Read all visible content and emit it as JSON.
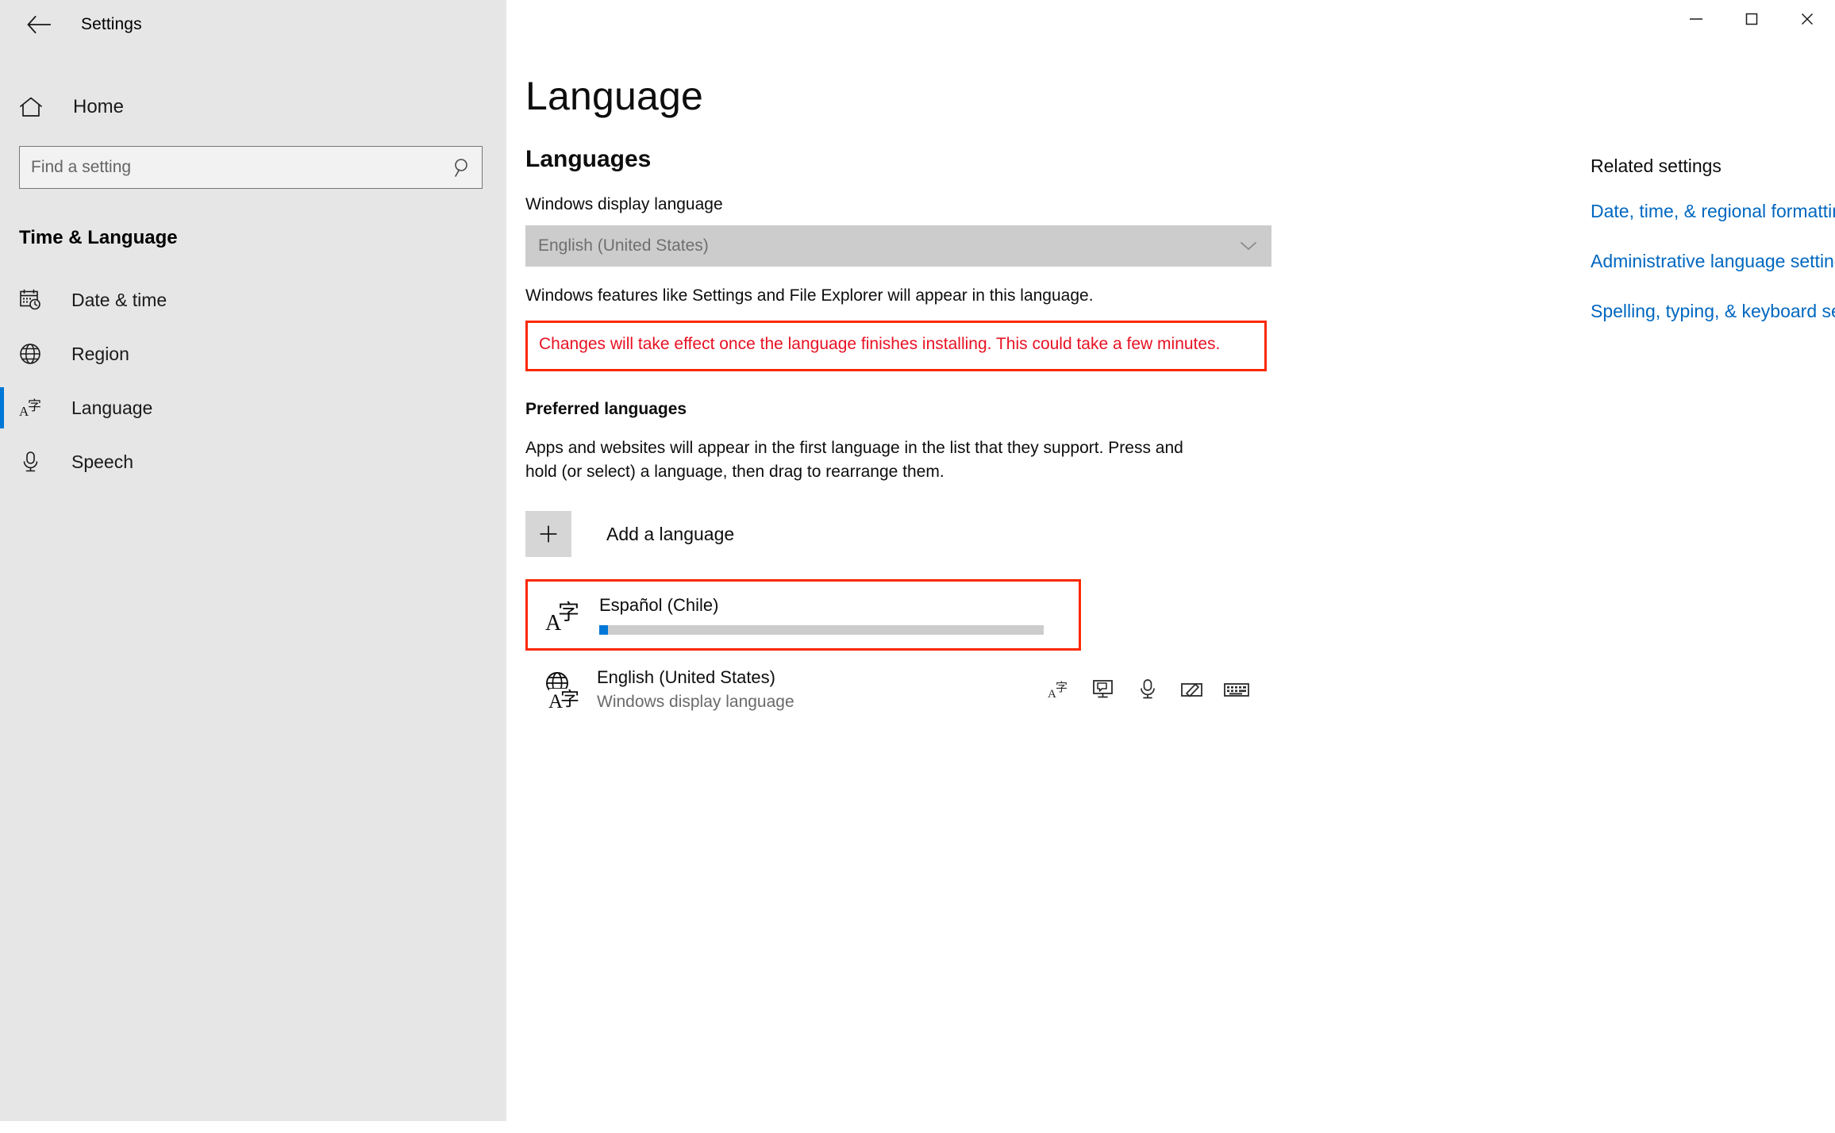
{
  "window": {
    "app_title": "Settings",
    "back_icon": "back-arrow-icon",
    "controls": {
      "minimize": "minimize-icon",
      "maximize": "maximize-icon",
      "close": "close-icon"
    }
  },
  "sidebar": {
    "home_label": "Home",
    "search": {
      "placeholder": "Find a setting",
      "value": "",
      "icon": "search-icon"
    },
    "category": "Time & Language",
    "items": [
      {
        "label": "Date & time",
        "icon": "calendar-clock-icon",
        "selected": false
      },
      {
        "label": "Region",
        "icon": "globe-icon",
        "selected": false
      },
      {
        "label": "Language",
        "icon": "language-icon",
        "selected": true
      },
      {
        "label": "Speech",
        "icon": "microphone-icon",
        "selected": false
      }
    ]
  },
  "main": {
    "page_title": "Language",
    "section_heading": "Languages",
    "display_language": {
      "label": "Windows display language",
      "value": "English (United States)",
      "disabled": true,
      "chevron_icon": "chevron-down-icon",
      "description": "Windows features like Settings and File Explorer will appear in this language."
    },
    "warning": {
      "text": "Changes will take effect once the language finishes installing. This could take a few minutes.",
      "color": "#e81123",
      "box_color": "#fa2800"
    },
    "preferred": {
      "heading": "Preferred languages",
      "description": "Apps and websites will appear in the first language in the list that they support. Press and hold (or select) a language, then drag to rearrange them.",
      "add_button": {
        "label": "Add a language",
        "icon": "plus-icon"
      },
      "languages": [
        {
          "name": "Español (Chile)",
          "subtitle": "",
          "icon": "language-pack-icon",
          "installing": true,
          "progress_percent": 2,
          "highlighted": true,
          "actions": []
        },
        {
          "name": "English (United States)",
          "subtitle": "Windows display language",
          "icon": "globe-language-icon",
          "installing": false,
          "progress_percent": 0,
          "highlighted": false,
          "actions": [
            "language-pack-icon",
            "text-to-speech-icon",
            "speech-recognition-icon",
            "handwriting-icon",
            "keyboard-icon"
          ]
        }
      ]
    }
  },
  "related": {
    "title": "Related settings",
    "links": [
      "Date, time, & regional formatting",
      "Administrative language settings",
      "Spelling, typing, & keyboard settings"
    ],
    "link_color": "#0067c0"
  }
}
